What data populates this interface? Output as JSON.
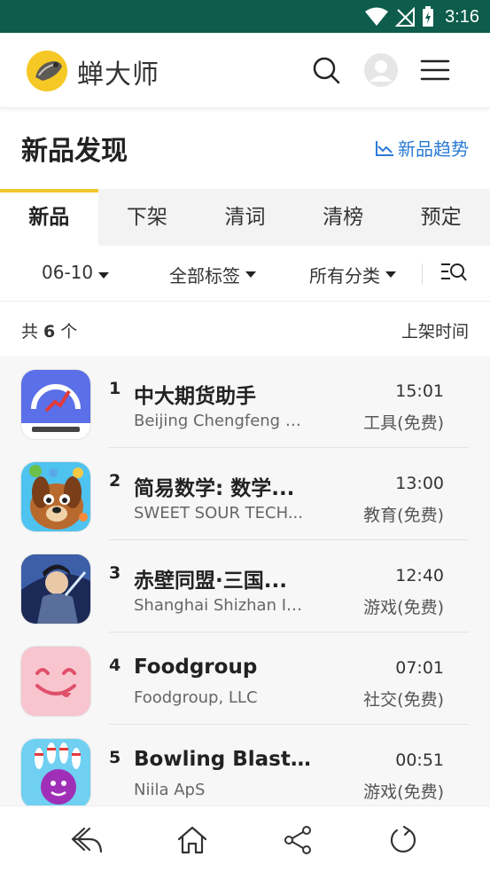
{
  "status": {
    "time": "3:16"
  },
  "header": {
    "brand": "蝉大师",
    "logo_icon": "cicada-logo-icon"
  },
  "page": {
    "title": "新品发现",
    "trend_link": "新品趋势"
  },
  "tabs": [
    {
      "label": "新品",
      "active": true
    },
    {
      "label": "下架",
      "active": false
    },
    {
      "label": "清词",
      "active": false
    },
    {
      "label": "清榜",
      "active": false
    },
    {
      "label": "预定",
      "active": false
    }
  ],
  "filters": {
    "date": "06-10",
    "tags": "全部标签",
    "category": "所有分类"
  },
  "summary": {
    "prefix": "共",
    "count": "6",
    "suffix": "个",
    "sort": "上架时间"
  },
  "items": [
    {
      "rank": "1",
      "name": "中大期货助手",
      "developer": "Beijing Chengfeng N...",
      "time": "15:01",
      "category": "工具(免费)"
    },
    {
      "rank": "2",
      "name": "简易数学: 数学...",
      "developer": "SWEET SOUR TECH...",
      "time": "13:00",
      "category": "教育(免费)"
    },
    {
      "rank": "3",
      "name": "赤壁同盟·三国...",
      "developer": "Shanghai Shizhan In...",
      "time": "12:40",
      "category": "游戏(免费)"
    },
    {
      "rank": "4",
      "name": "Foodgroup",
      "developer": "Foodgroup, LLC",
      "time": "07:01",
      "category": "社交(免费)"
    },
    {
      "rank": "5",
      "name": "Bowling Blast B...",
      "developer": "Niila ApS",
      "time": "00:51",
      "category": "游戏(免费)"
    }
  ],
  "colors": {
    "status_bar": "#0d5c4c",
    "accent": "#f2c62a",
    "link": "#2a7bd6"
  }
}
